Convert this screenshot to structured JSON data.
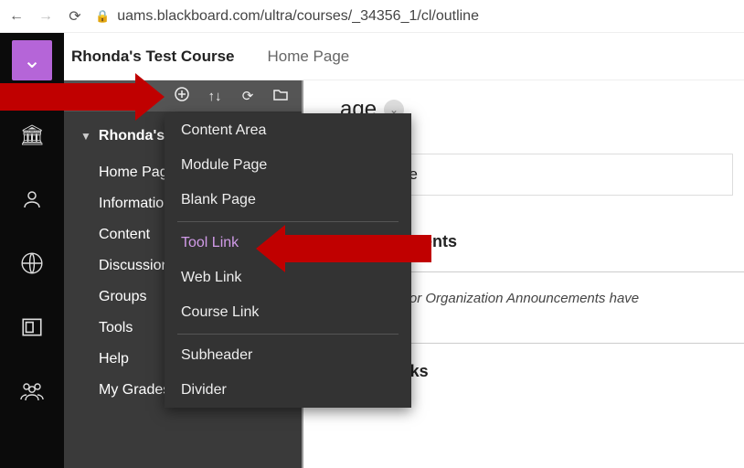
{
  "browser": {
    "url": "uams.blackboard.com/ultra/courses/_34356_1/cl/outline"
  },
  "breadcrumb": {
    "course": "Rhonda's Test Course",
    "page": "Home Page"
  },
  "sidebar": {
    "root": "Rhonda's Test Course",
    "items": [
      {
        "label": "Home Page",
        "expandable": false
      },
      {
        "label": "Information",
        "expandable": false
      },
      {
        "label": "Content",
        "expandable": false
      },
      {
        "label": "Discussions",
        "expandable": false
      },
      {
        "label": "Groups",
        "expandable": false
      },
      {
        "label": "Tools",
        "expandable": false
      },
      {
        "label": "Help",
        "expandable": true
      },
      {
        "label": "My Grades",
        "expandable": true
      }
    ]
  },
  "popup": {
    "groups": [
      [
        "Content Area",
        "Module Page",
        "Blank Page"
      ],
      [
        "Tool Link",
        "Web Link",
        "Course Link"
      ],
      [
        "Subheader",
        "Divider"
      ]
    ],
    "highlighted": "Tool Link"
  },
  "main": {
    "title_suffix": "age",
    "module_suffix": "e Module",
    "announcements_head": "nnouncements",
    "announcements_body": "No Course or Organization Announcements have",
    "tasks_head": "My Tasks"
  }
}
